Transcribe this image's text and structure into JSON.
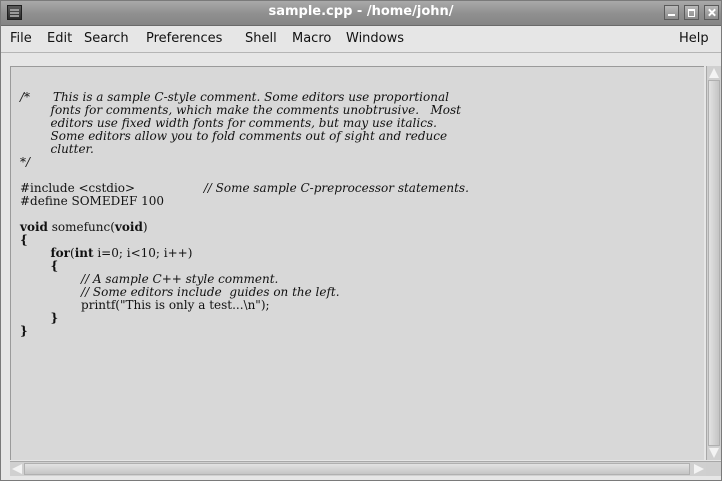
{
  "window": {
    "title": "sample.cpp - /home/john/"
  },
  "menubar": {
    "file": "File",
    "edit": "Edit",
    "search": "Search",
    "preferences": "Preferences",
    "shell": "Shell",
    "macro": "Macro",
    "windows": "Windows",
    "help": "Help"
  },
  "editor": {
    "comment_open": "/*",
    "comment_body": [
      "This is a sample C-style comment. Some editors use proportional",
      "fonts for comments, which make the comments unobtrusive.   Most",
      "editors use fixed width fonts for comments, but may use italics.",
      "Some editors allow you to fold comments out of sight and reduce",
      "clutter."
    ],
    "comment_close": "*/",
    "include": "#include <cstdio>",
    "include_comment": "// Some sample C-preprocessor statements.",
    "define": "#define SOMEDEF 100",
    "func_kw": "void",
    "func_name": " somefunc(",
    "func_param": "void",
    "func_close": ")",
    "brace_open": "{",
    "for_kw": "for",
    "for_paren": "(",
    "int_kw": "int",
    "for_rest": " i=0; i<10; i++)",
    "inner_brace_open": "{",
    "inner_comment_1": "// A sample C++ style comment.",
    "inner_comment_2": "// Some editors include  guides on the left.",
    "printf_line": "printf(\"This is only a test...\\n\");",
    "inner_brace_close": "}",
    "brace_close": "}"
  },
  "icons": {
    "app": "app-icon",
    "minimize": "minimize-icon",
    "maximize": "maximize-icon",
    "close": "close-icon"
  },
  "colors": {
    "titlebar": "#8f8f8f",
    "editor_bg": "#d8d8d8",
    "window_bg": "#e6e6e6"
  }
}
